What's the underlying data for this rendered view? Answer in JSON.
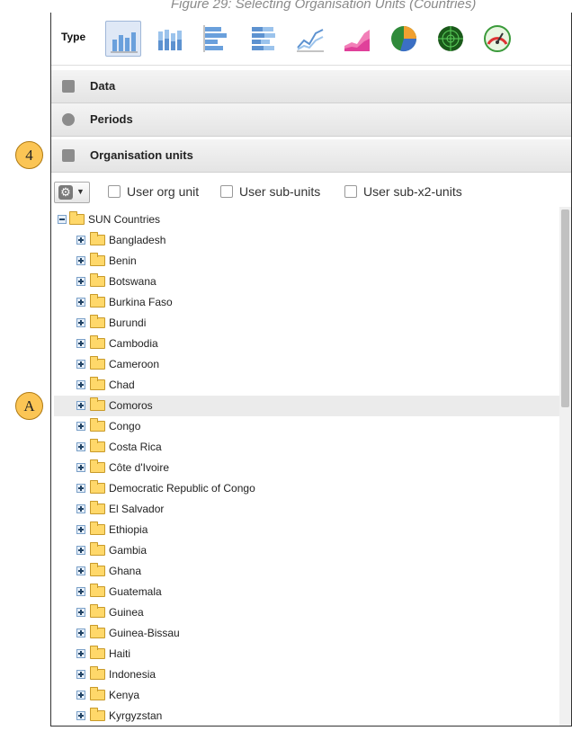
{
  "caption": "Figure 29: Selecting Organisation Units (Countries)",
  "type_label": "Type",
  "chart_type_icons": [
    {
      "name": "column-chart-icon"
    },
    {
      "name": "stacked-column-chart-icon"
    },
    {
      "name": "bar-chart-icon"
    },
    {
      "name": "stacked-bar-chart-icon"
    },
    {
      "name": "line-chart-icon"
    },
    {
      "name": "area-chart-icon"
    },
    {
      "name": "pie-chart-icon"
    },
    {
      "name": "radar-chart-icon"
    },
    {
      "name": "gauge-chart-icon"
    }
  ],
  "sections": {
    "data": "Data",
    "periods": "Periods",
    "org_units": "Organisation units"
  },
  "toolbar": {
    "user_org_unit": "User org unit",
    "user_sub_units": "User sub-units",
    "user_sub_x2_units": "User sub-x2-units"
  },
  "tree": {
    "root": "SUN Countries",
    "children": [
      "Bangladesh",
      "Benin",
      "Botswana",
      "Burkina Faso",
      "Burundi",
      "Cambodia",
      "Cameroon",
      "Chad",
      "Comoros",
      "Congo",
      "Costa Rica",
      "Côte d'Ivoire",
      "Democratic Republic of Congo",
      "El Salvador",
      "Ethiopia",
      "Gambia",
      "Ghana",
      "Guatemala",
      "Guinea",
      "Guinea-Bissau",
      "Haiti",
      "Indonesia",
      "Kenya",
      "Kyrgyzstan"
    ],
    "highlighted": "Comoros"
  },
  "callouts": {
    "step": "4",
    "marker": "A"
  },
  "colors": {
    "callout": "#fbc555",
    "folder": "#ffd86a",
    "highlight": "#ebebeb"
  }
}
